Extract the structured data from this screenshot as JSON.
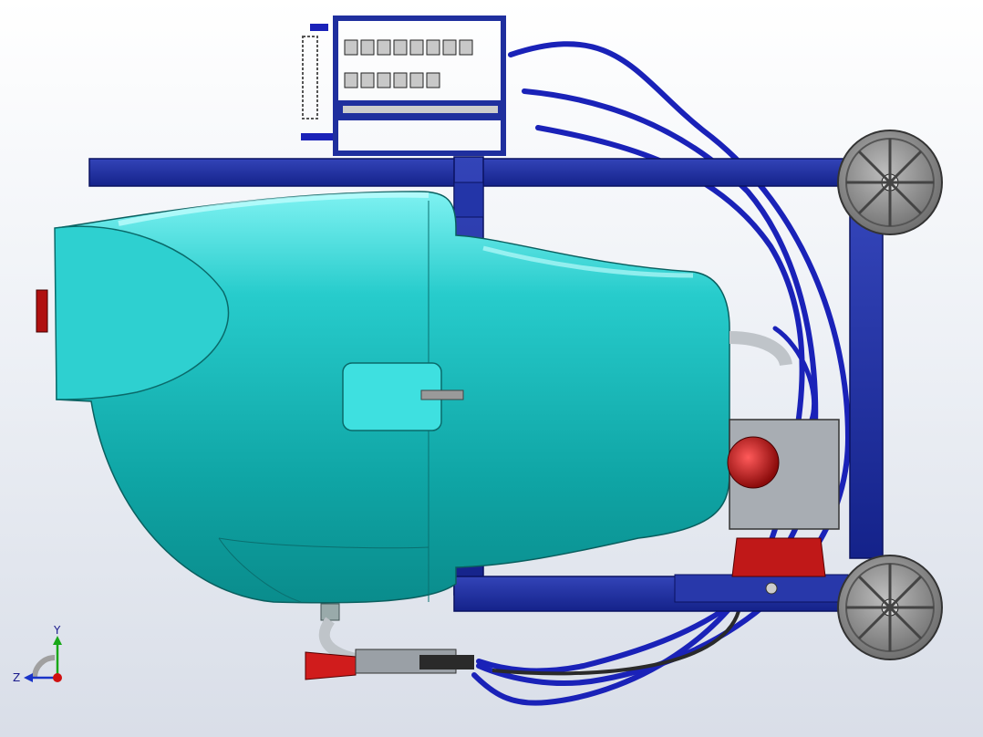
{
  "viewport": {
    "background_top": "#ffffff",
    "background_bottom": "#d9dee8"
  },
  "model": {
    "frame_color": "#1f2f9e",
    "tank_color": "#1fb7b7",
    "hose_color": "#1a22b8",
    "pump_color": "#c01818",
    "wheel_color": "#8a8a8a"
  },
  "triad": {
    "x_label": "",
    "y_label": "Y",
    "z_label": "Z",
    "y_color": "#18a818",
    "z_color": "#1a34c8",
    "origin_color": "#d01010"
  }
}
